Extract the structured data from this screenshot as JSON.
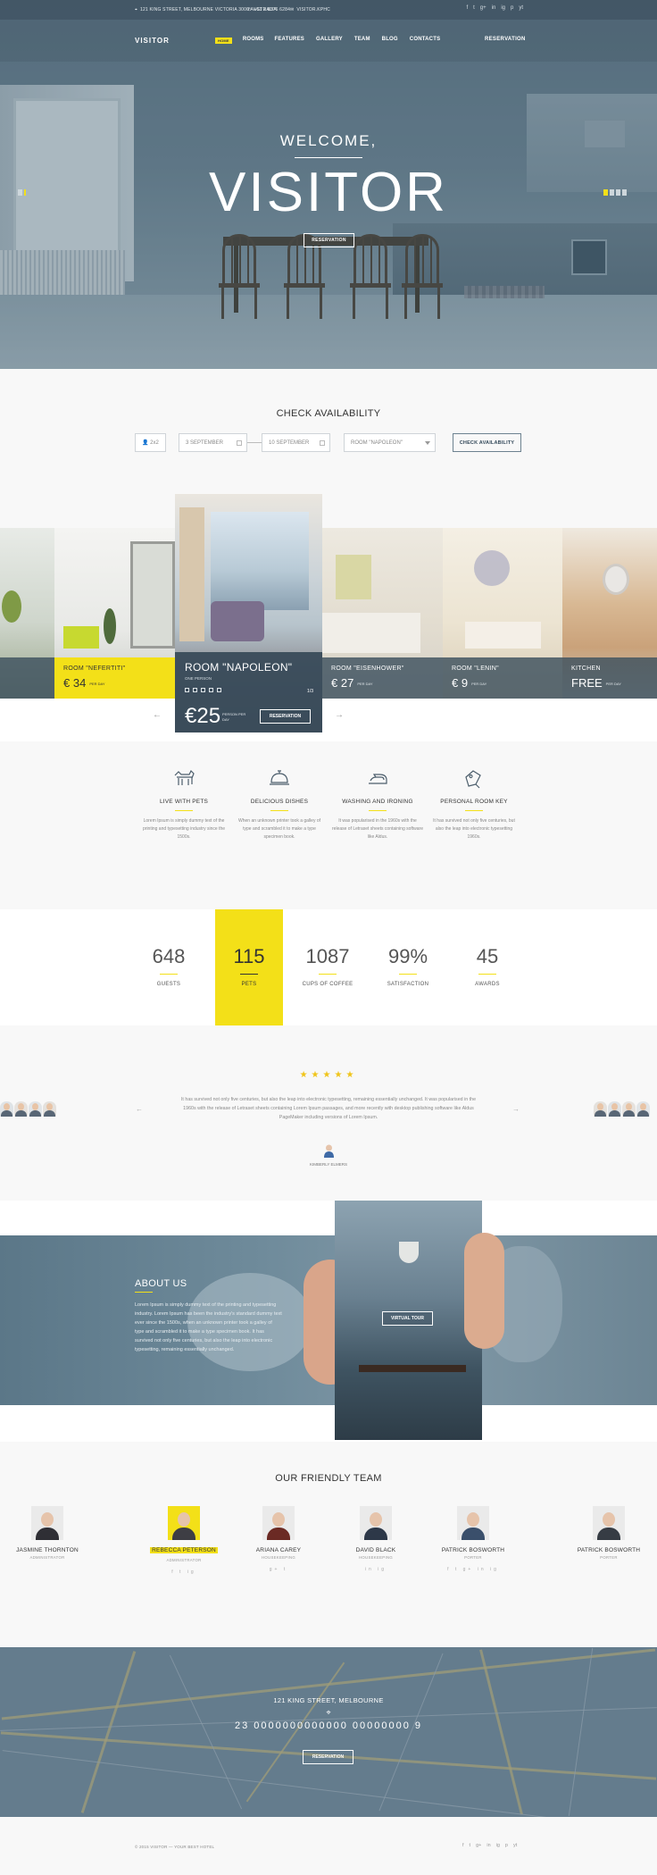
{
  "topbar": {
    "address": "121 KING STREET, MELBOURNE VICTORIA 3000 AUSTRALIA",
    "phone": "+61 3 8376 6284",
    "email": "VISITOR.KPHC",
    "socials": [
      "f",
      "t",
      "g+",
      "in",
      "ig",
      "p",
      "yt"
    ]
  },
  "nav": {
    "logo": "VISITOR",
    "items": [
      "HOME",
      "ROOMS",
      "FEATURES",
      "GALLERY",
      "TEAM",
      "BLOG",
      "CONTACTS"
    ],
    "reservation": "RESERVATION"
  },
  "hero": {
    "welcome": "WELCOME,",
    "title": "VISITOR",
    "button": "RESERVATION"
  },
  "availability": {
    "title": "CHECK AVAILABILITY",
    "guests": "2x2",
    "checkin": "3 SEPTEMBER",
    "checkout": "10 SEPTEMBER",
    "room": "ROOM \"NAPOLEON\"",
    "button": "CHECK AVAILABILITY"
  },
  "rooms": {
    "items": [
      {
        "name": "ROOM \"NEFERTITI\"",
        "price": "€ 34",
        "per": "PER DAY"
      },
      {
        "name": "ROOM \"EISENHOWER\"",
        "price": "€ 27",
        "per": "PER DAY"
      },
      {
        "name": "ROOM \"LENIN\"",
        "price": "€ 9",
        "per": "PER DAY"
      },
      {
        "name": "KITCHEN",
        "price": "FREE",
        "per": "PER DAY"
      }
    ],
    "featured": {
      "name": "ROOM \"NAPOLEON\"",
      "sub": "ONE PERSON",
      "price": "€25",
      "per": "PERSON PER DAY",
      "button": "RESERVATION",
      "counter": "1/3"
    }
  },
  "features": [
    {
      "title": "LIVE WITH PETS",
      "text": "Lorem Ipsum is simply dummy text of the printing and typesetting industry since the 1500s."
    },
    {
      "title": "DELICIOUS DISHES",
      "text": "When an unknown printer took a galley of type and scrambled it to make a type specimen book."
    },
    {
      "title": "WASHING AND IRONING",
      "text": "It was popularised in the 1960s with the release of Letraset sheets containing software like Aldus."
    },
    {
      "title": "PERSONAL ROOM KEY",
      "text": "It has survived not only five centuries, but also the leap into electronic typesetting 1960s."
    }
  ],
  "stats": [
    {
      "num": "648",
      "label": "GUESTS"
    },
    {
      "num": "115",
      "label": "PETS"
    },
    {
      "num": "1087",
      "label": "CUPS OF COFFEE"
    },
    {
      "num": "99%",
      "label": "SATISFACTION"
    },
    {
      "num": "45",
      "label": "AWARDS"
    }
  ],
  "testimonial": {
    "stars": "★★★★★",
    "quote": "It has survived not only five centuries, but also the leap into electronic typesetting, remaining essentially unchanged. It was popularised in the 1960s with the release of Letraset sheets containing Lorem Ipsum passages, and more recently with desktop publishing software like Aldus PageMaker including versions of Lorem Ipsum.",
    "author": "KIMBERLY ELMERS"
  },
  "about": {
    "title": "ABOUT US",
    "text": "Lorem Ipsum is simply dummy text of the printing and typesetting industry. Lorem Ipsum has been the industry's standard dummy text ever since the 1500s, when an unknown printer took a galley of type and scrambled it to make a type specimen book. It has survived not only five centuries, but also the leap into electronic typesetting, remaining essentially unchanged.",
    "button": "VIRTUAL TOUR"
  },
  "team": {
    "title": "OUR FRIENDLY TEAM",
    "members": [
      {
        "name": "JASMINE THORNTON",
        "role": "ADMINISTRATOR",
        "socials": ""
      },
      {
        "name": "REBECCA PETERSON",
        "role": "ADMINISTRATOR",
        "socials": "f t ig"
      },
      {
        "name": "ARIANA CAREY",
        "role": "HOUSEKEEPING",
        "socials": "g+ t"
      },
      {
        "name": "DAVID BLACK",
        "role": "HOUSEKEEPING",
        "socials": "in ig"
      },
      {
        "name": "PATRICK BOSWORTH",
        "role": "PORTER",
        "socials": "f t g+ in ig"
      },
      {
        "name": "PATRICK BOSWORTH",
        "role": "PORTER",
        "socials": ""
      }
    ]
  },
  "map": {
    "address": "121 KING STREET, MELBOURNE",
    "pin": "⌖",
    "phone": "23 0000000000000 00000000 9",
    "button": "RESERVATION"
  },
  "footer": {
    "copyright": "© 2015 VISITOR — YOUR BEST HOTEL",
    "socials": [
      "f",
      "t",
      "g+",
      "in",
      "ig",
      "p",
      "yt"
    ]
  },
  "colors": {
    "accent": "#f3e018",
    "dark": "#3d505e",
    "bg": "#f8f8f8"
  }
}
